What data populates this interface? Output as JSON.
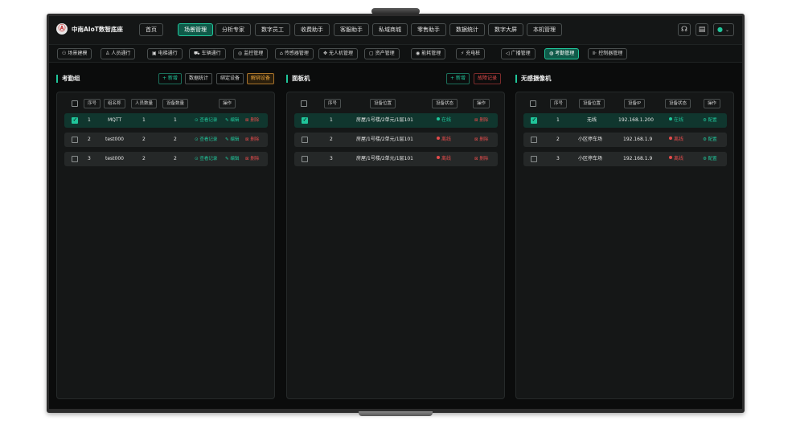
{
  "topnav": {
    "brand": "中南AIoT数智底座",
    "logo_glyph": "Ⓐ",
    "tabs": [
      {
        "label": "首页",
        "active": false
      },
      {
        "label": "场景管理",
        "active": true
      },
      {
        "label": "分析专家",
        "active": false
      },
      {
        "label": "数字员工",
        "active": false
      },
      {
        "label": "收费助手",
        "active": false
      },
      {
        "label": "客服助手",
        "active": false
      },
      {
        "label": "私域商城",
        "active": false
      },
      {
        "label": "零售助手",
        "active": false
      },
      {
        "label": "数据统计",
        "active": false
      },
      {
        "label": "数字大屏",
        "active": false
      },
      {
        "label": "本机管理",
        "active": false
      }
    ],
    "icons": [
      "headset-icon",
      "display-icon",
      "user-icon"
    ]
  },
  "subnav": {
    "items": [
      {
        "label": "场景建模",
        "icon": "⚇",
        "active": false
      },
      {
        "label": "人员通行",
        "icon": "♙",
        "active": false
      },
      {
        "label": "电梯通行",
        "icon": "▣",
        "active": false
      },
      {
        "label": "车辆通行",
        "icon": "⛟",
        "active": false
      },
      {
        "label": "监控管理",
        "icon": "◎",
        "active": false
      },
      {
        "label": "传感器管理",
        "icon": "⌂",
        "active": false
      },
      {
        "label": "无人机管理",
        "icon": "✥",
        "active": false
      },
      {
        "label": "资产管理",
        "icon": "▢",
        "active": false
      },
      {
        "label": "能耗管理",
        "icon": "◉",
        "active": false
      },
      {
        "label": "充电桩",
        "icon": "⚡",
        "active": false
      },
      {
        "label": "广播管理",
        "icon": "◁",
        "active": false
      },
      {
        "label": "考勤管理",
        "icon": "◍",
        "active": true
      },
      {
        "label": "控制器管理",
        "icon": "⊪",
        "active": false
      }
    ]
  },
  "panels": {
    "attendance": {
      "title": "考勤组",
      "buttons": {
        "add": "+ 新增",
        "stats": "数据统计",
        "bind": "绑定设备",
        "unbind": "解绑设备"
      },
      "headers": [
        "序号",
        "组名称",
        "人员数量",
        "设备数量",
        "操作"
      ],
      "rows": [
        {
          "no": "1",
          "name": "MQTT",
          "people": "1",
          "devices": "1",
          "selected": true
        },
        {
          "no": "2",
          "name": "test000",
          "people": "2",
          "devices": "2",
          "selected": false
        },
        {
          "no": "3",
          "name": "test000",
          "people": "2",
          "devices": "2",
          "selected": false
        }
      ],
      "actions": {
        "view": "⊙ 查看记录",
        "edit": "✎ 编辑",
        "delete": "⊠ 删除"
      }
    },
    "panel_machine": {
      "title": "面板机",
      "buttons": {
        "add": "+ 新增",
        "fault": "故障记录"
      },
      "headers": [
        "序号",
        "设备位置",
        "设备状态",
        "操作"
      ],
      "rows": [
        {
          "no": "1",
          "location": "房屋/1号楼/2单元/1层101",
          "status": "在线",
          "online": true,
          "selected": true
        },
        {
          "no": "2",
          "location": "房屋/1号楼/2单元/1层101",
          "status": "离线",
          "online": false,
          "selected": false
        },
        {
          "no": "3",
          "location": "房屋/1号楼/2单元/1层101",
          "status": "离线",
          "online": false,
          "selected": false
        }
      ],
      "actions": {
        "delete": "⊠ 删除"
      }
    },
    "camera": {
      "title": "无感摄像机",
      "headers": [
        "序号",
        "设备位置",
        "设备IP",
        "设备状态",
        "操作"
      ],
      "rows": [
        {
          "no": "1",
          "location": "无线",
          "ip": "192.168.1.200",
          "status": "在线",
          "online": true,
          "selected": true
        },
        {
          "no": "2",
          "location": "小区停车场",
          "ip": "192.168.1.9",
          "status": "离线",
          "online": false,
          "selected": false
        },
        {
          "no": "3",
          "location": "小区停车场",
          "ip": "192.168.1.9",
          "status": "离线",
          "online": false,
          "selected": false
        }
      ],
      "actions": {
        "config": "⚙ 配置"
      }
    }
  },
  "colors": {
    "accent": "#20c69b",
    "danger": "#e24b4b",
    "warning": "#e8a33a",
    "background": "#0b0c0c"
  }
}
